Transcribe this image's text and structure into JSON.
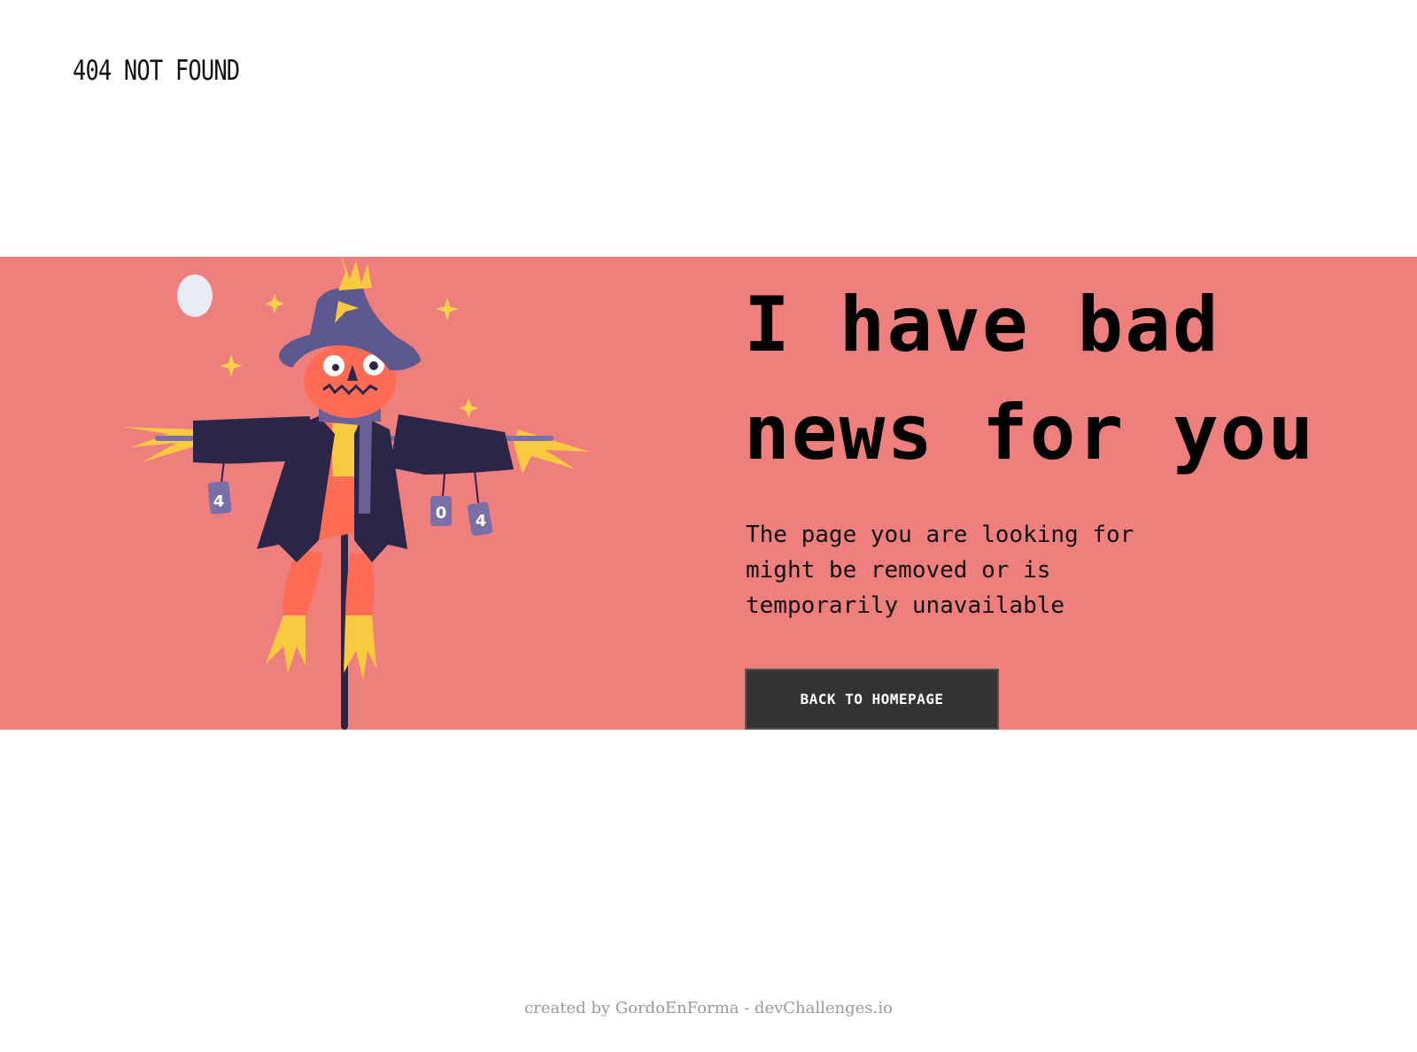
{
  "header": {
    "logo_text": "404 NOT FOUND"
  },
  "hero": {
    "headline_line1": "I have bad",
    "headline_line2": "news for you",
    "message": "The page you are looking for might be removed or is temporarily unavailable",
    "button_label": "BACK TO HOMEPAGE",
    "band_color": "#ef7f7d",
    "illustration": {
      "name": "scarecrow-illustration",
      "can_labels": [
        "4",
        "0",
        "4"
      ]
    }
  },
  "footer": {
    "credit": "created by GordoEnForma - devChallenges.io"
  },
  "colors": {
    "band": "#ef7f7d",
    "button_bg": "#333333",
    "text": "#000000"
  }
}
